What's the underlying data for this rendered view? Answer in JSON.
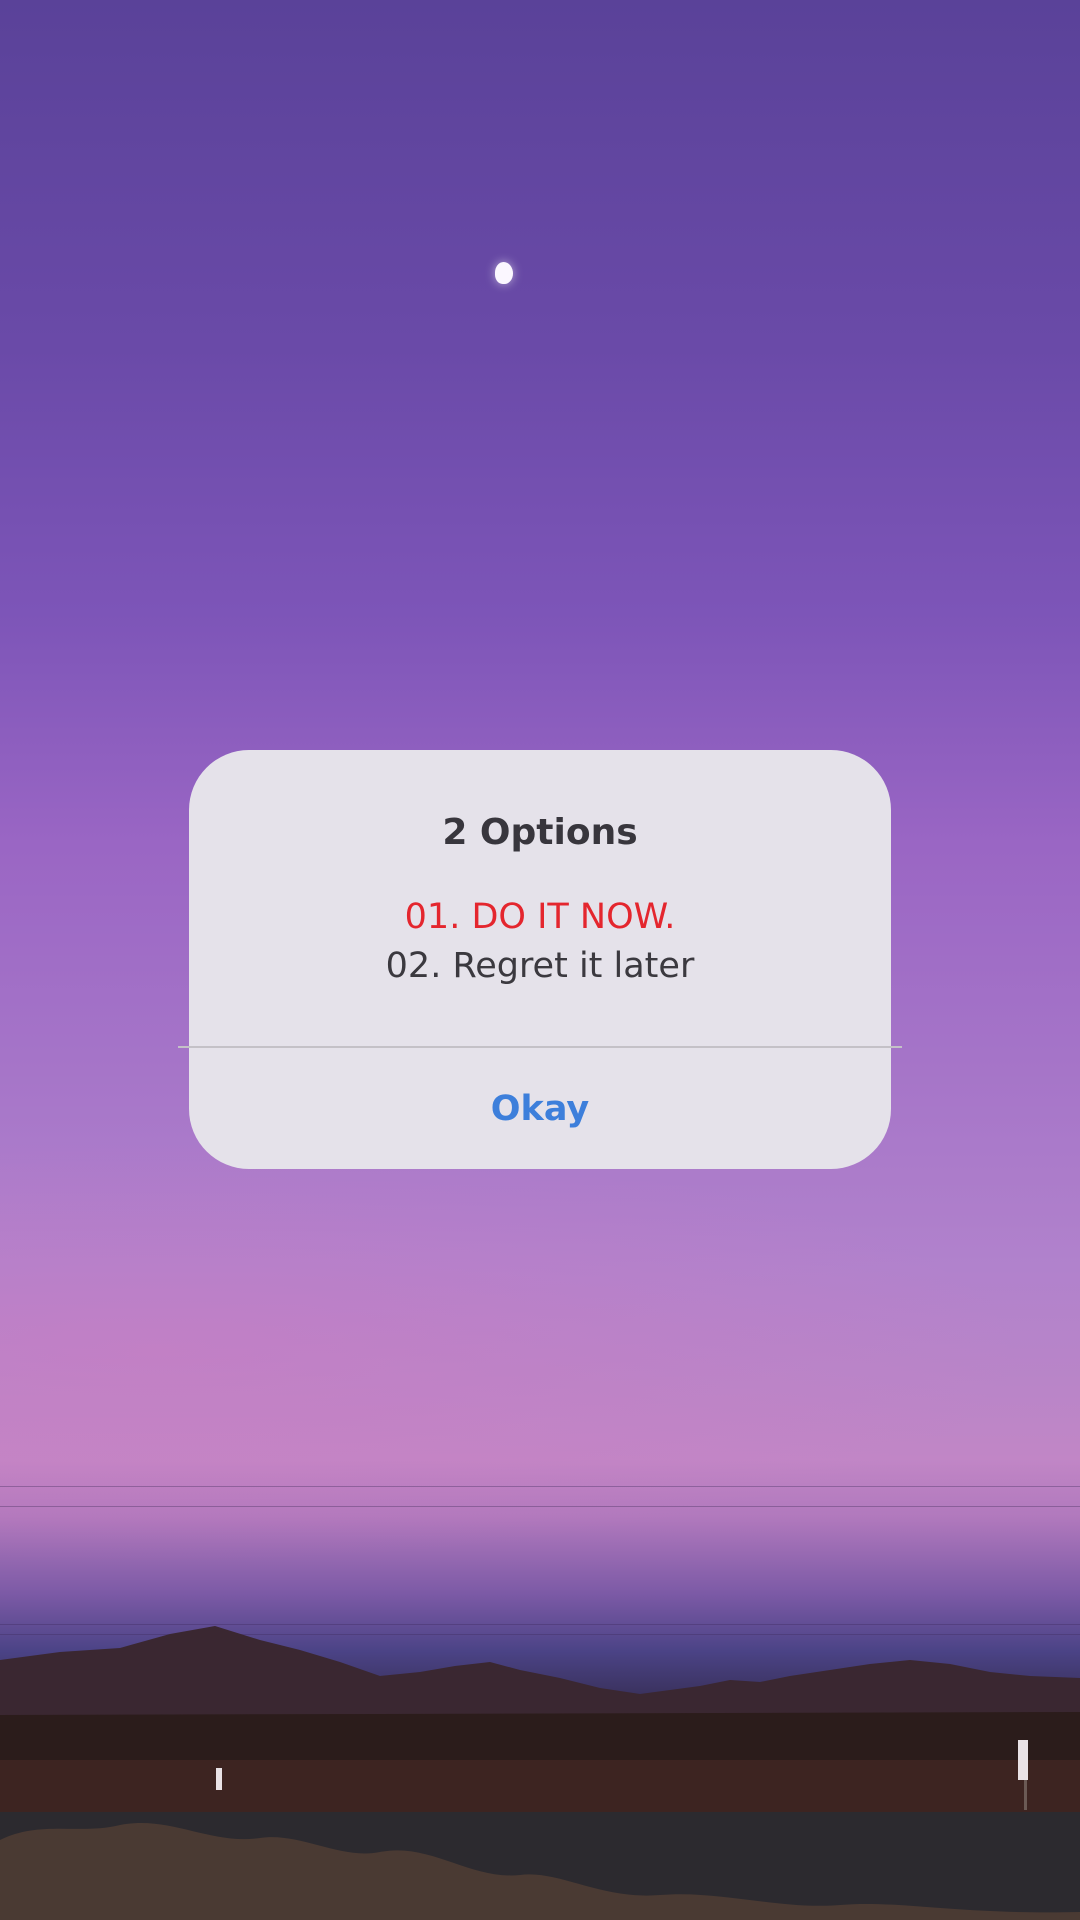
{
  "dialog": {
    "title": "2 Options",
    "options": [
      {
        "label": "01. DO IT NOW.",
        "color": "#e4262e"
      },
      {
        "label": "02. Regret it later",
        "color": "#3b393f"
      }
    ],
    "confirm_label": "Okay",
    "confirm_color": "#3d7fdb",
    "background": "#e5e2ea"
  }
}
